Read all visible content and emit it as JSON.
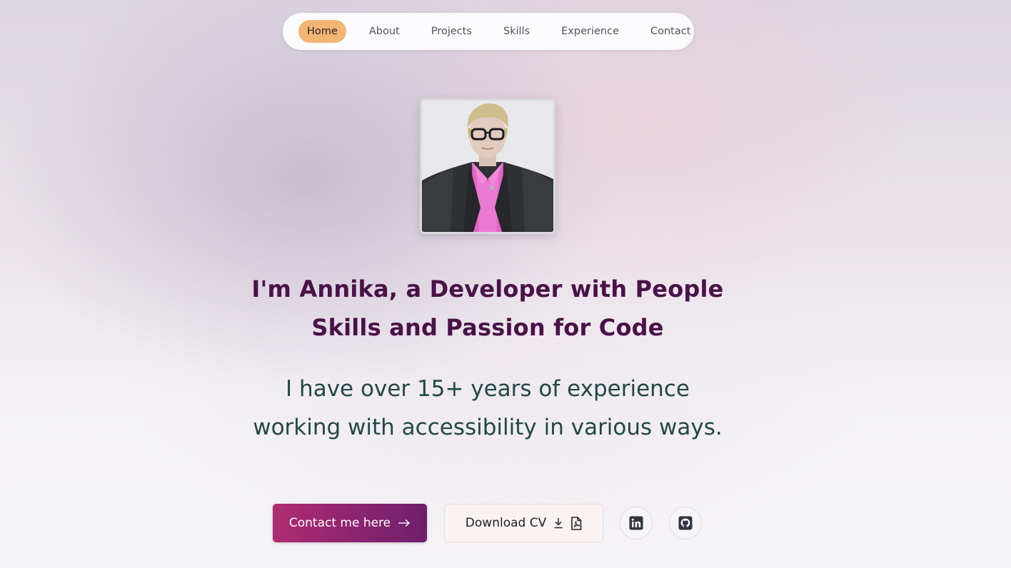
{
  "nav": {
    "items": [
      {
        "label": "Home",
        "active": true
      },
      {
        "label": "About",
        "active": false
      },
      {
        "label": "Projects",
        "active": false
      },
      {
        "label": "Skills",
        "active": false
      },
      {
        "label": "Experience",
        "active": false
      },
      {
        "label": "Contact",
        "active": false
      }
    ]
  },
  "hero": {
    "headline_line1": "I'm Annika, a Developer with People",
    "headline_line2": "Skills and Passion for Code",
    "subline_line1": "I have over 15+ years of experience",
    "subline_line2": "working with accessibility in various ways.",
    "contact_button": "Contact me here",
    "cv_button": "Download CV"
  },
  "icons": {
    "contact": "arrow-right-icon",
    "cv_download": "download-icon",
    "cv_pdf": "pdf-file-icon",
    "linkedin": "linkedin-icon",
    "github": "github-icon"
  },
  "colors": {
    "nav_active": "#f2b574",
    "headline": "#4a1248",
    "subline": "#234844",
    "contact_button_start": "#b02c72",
    "contact_button_end": "#6e1f69"
  }
}
